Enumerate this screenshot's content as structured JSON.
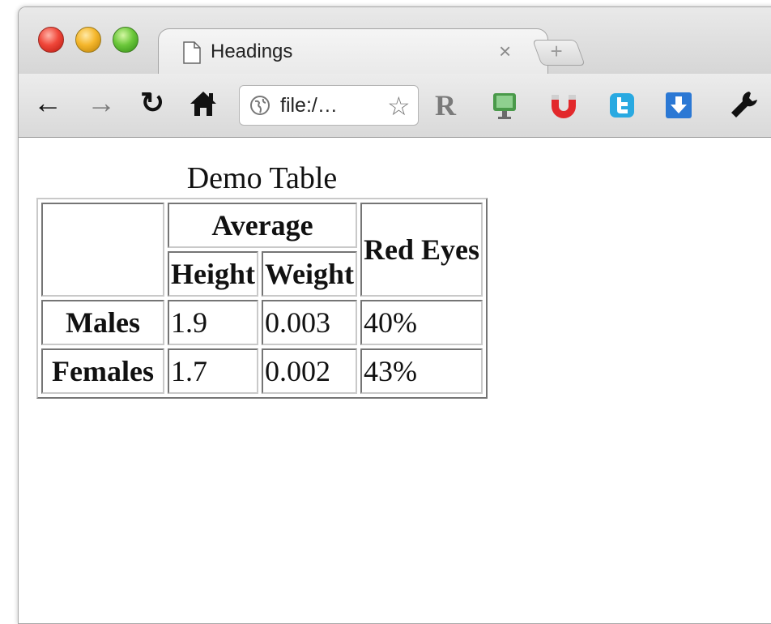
{
  "browser": {
    "tab_title": "Headings",
    "tab_close": "×",
    "new_tab": "+",
    "url": "file:/…",
    "extension_r": "R"
  },
  "page": {
    "caption": "Demo Table",
    "table": {
      "group_header": "Average",
      "red_eyes_header": "Red Eyes",
      "sub_headers": [
        "Height",
        "Weight"
      ],
      "rows": [
        {
          "label": "Males",
          "height": "1.9",
          "weight": "0.003",
          "red_eyes": "40%"
        },
        {
          "label": "Females",
          "height": "1.7",
          "weight": "0.002",
          "red_eyes": "43%"
        }
      ]
    }
  },
  "colors": {
    "close": "#f0473a",
    "minimize": "#f5b72c",
    "zoom": "#6cc83b",
    "twitter": "#29a9e1",
    "download": "#2b78d4"
  }
}
